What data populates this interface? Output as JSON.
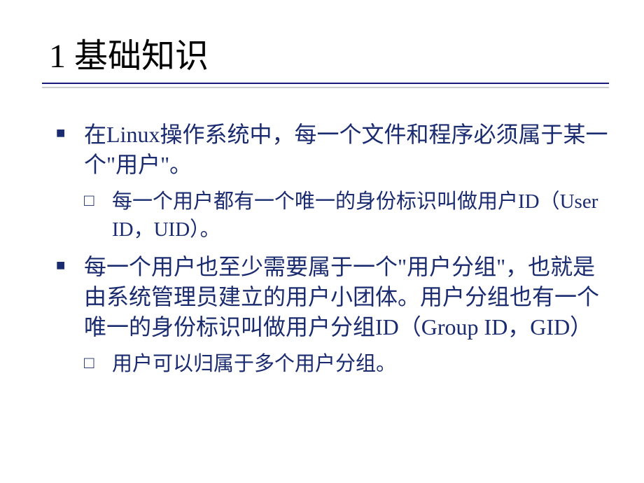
{
  "title": "1 基础知识",
  "bullets": {
    "item1": "在Linux操作系统中，每一个文件和程序必须属于某一个\"用户\"。",
    "sub1": "每一个用户都有一个唯一的身份标识叫做用户ID（User ID，UID）。",
    "item2": "每一个用户也至少需要属于一个\"用户分组\"，也就是由系统管理员建立的用户小团体。用户分组也有一个唯一的身份标识叫做用户分组ID（Group ID，GID）",
    "sub2": "用户可以归属于多个用户分组。"
  }
}
